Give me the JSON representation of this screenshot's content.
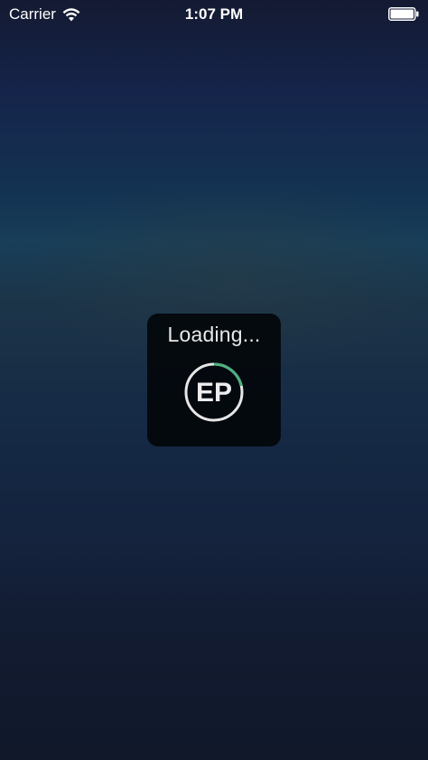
{
  "status_bar": {
    "carrier": "Carrier",
    "time": "1:07 PM",
    "wifi_icon": "wifi-icon",
    "battery_icon": "battery-icon"
  },
  "loading_hud": {
    "label": "Loading...",
    "logo_text": "EP",
    "progress_arc_color": "#4caf7d",
    "ring_color": "#e6e6e6"
  },
  "colors": {
    "hud_background": "#04080c",
    "text": "#ffffff"
  }
}
